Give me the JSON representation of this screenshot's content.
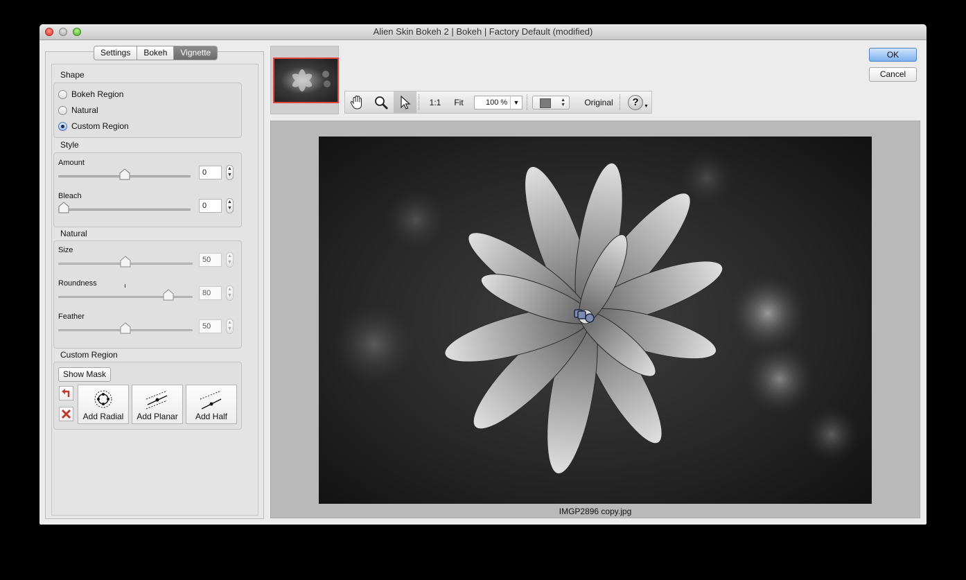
{
  "window": {
    "title": "Alien Skin Bokeh 2 | Bokeh | Factory Default (modified)"
  },
  "tabs": [
    {
      "label": "Settings",
      "active": false
    },
    {
      "label": "Bokeh",
      "active": false
    },
    {
      "label": "Vignette",
      "active": true
    }
  ],
  "shape": {
    "title": "Shape",
    "options": [
      {
        "label": "Bokeh Region",
        "selected": false
      },
      {
        "label": "Natural",
        "selected": false
      },
      {
        "label": "Custom Region",
        "selected": true
      }
    ]
  },
  "style": {
    "title": "Style",
    "amount": {
      "label": "Amount",
      "value": "0",
      "level": 0.5
    },
    "bleach": {
      "label": "Bleach",
      "value": "0",
      "level": 0.0
    }
  },
  "natural": {
    "title": "Natural",
    "size": {
      "label": "Size",
      "value": "50",
      "level": 0.5
    },
    "roundness": {
      "label": "Roundness",
      "value": "80",
      "level": 0.85
    },
    "feather": {
      "label": "Feather",
      "value": "50",
      "level": 0.5
    }
  },
  "custom_region": {
    "title": "Custom Region",
    "show_mask": "Show Mask",
    "add_radial": "Add Radial",
    "add_planar": "Add Planar",
    "add_half": "Add Half"
  },
  "toolbar": {
    "one_to_one": "1:1",
    "fit": "Fit",
    "zoom": "100 %",
    "original": "Original",
    "help": "?"
  },
  "dialog": {
    "ok": "OK",
    "cancel": "Cancel"
  },
  "preview": {
    "filename": "IMGP2896 copy.jpg"
  },
  "colors": {
    "accent": "#4f7fc4",
    "thumbnail_border": "#e0443a",
    "guide_line": "#5f6a8c"
  }
}
